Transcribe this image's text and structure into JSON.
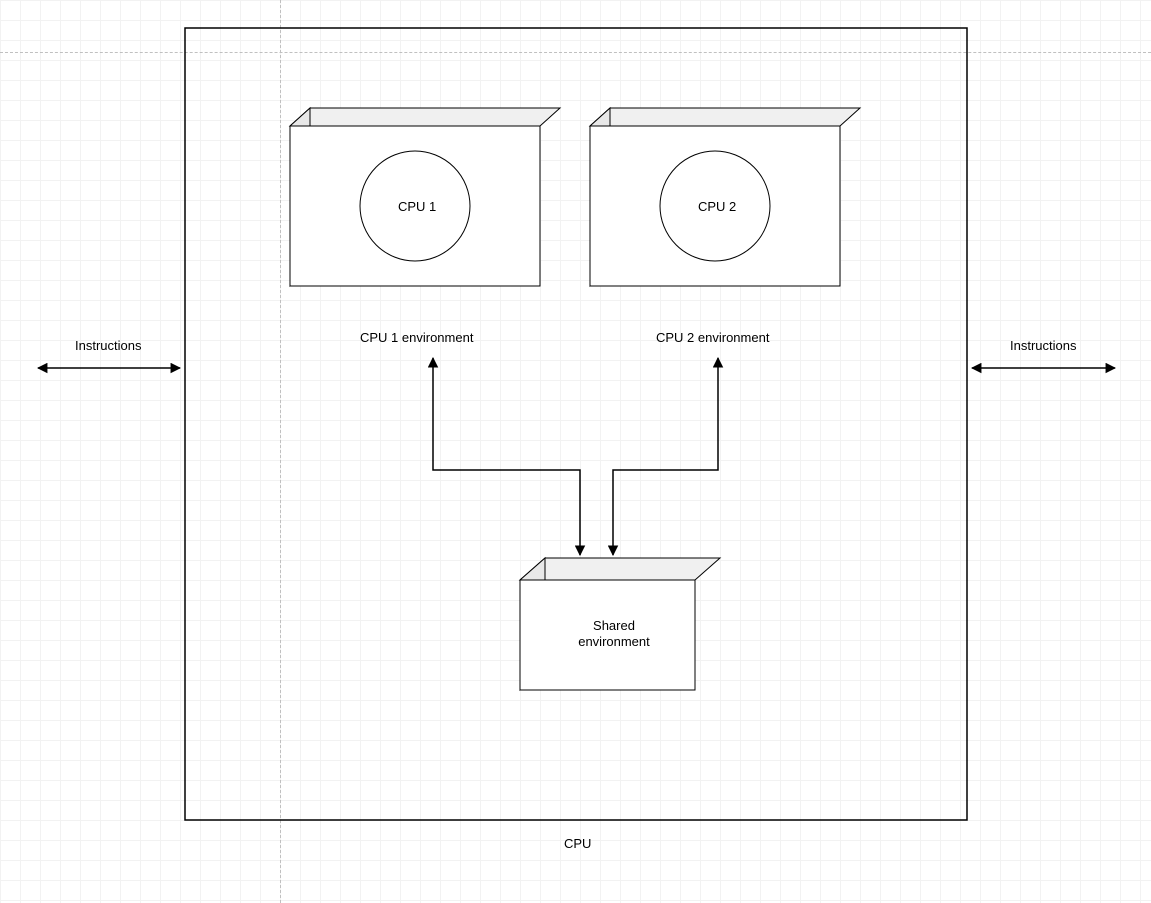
{
  "diagram": {
    "container_label": "CPU",
    "cpu1": {
      "circle_label": "CPU 1",
      "env_label": "CPU 1 environment"
    },
    "cpu2": {
      "circle_label": "CPU 2",
      "env_label": "CPU 2 environment"
    },
    "shared": {
      "box_label": "Shared\nenvironment"
    },
    "left_arrow_label": "Instructions",
    "right_arrow_label": "Instructions"
  }
}
